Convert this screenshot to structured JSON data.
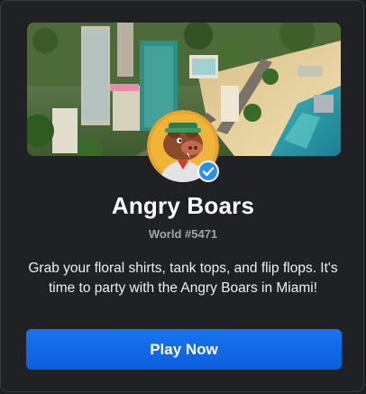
{
  "world": {
    "name": "Angry Boars",
    "subtitle": "World #5471",
    "description": "Grab your floral shirts, tank tops, and flip flops. It's time to party with the Angry Boars in Miami!",
    "verified": true
  },
  "banner": {
    "image": "miami-voxel-city-banner"
  },
  "avatar": {
    "image": "angry-boar-logo",
    "badge": "verified-checkmark-icon"
  },
  "actions": {
    "play_label": "Play Now"
  },
  "colors": {
    "background": "#202124",
    "button": "#0d66e8",
    "verified": "#2b8ff0",
    "avatar_ring": "#e8a32a"
  }
}
